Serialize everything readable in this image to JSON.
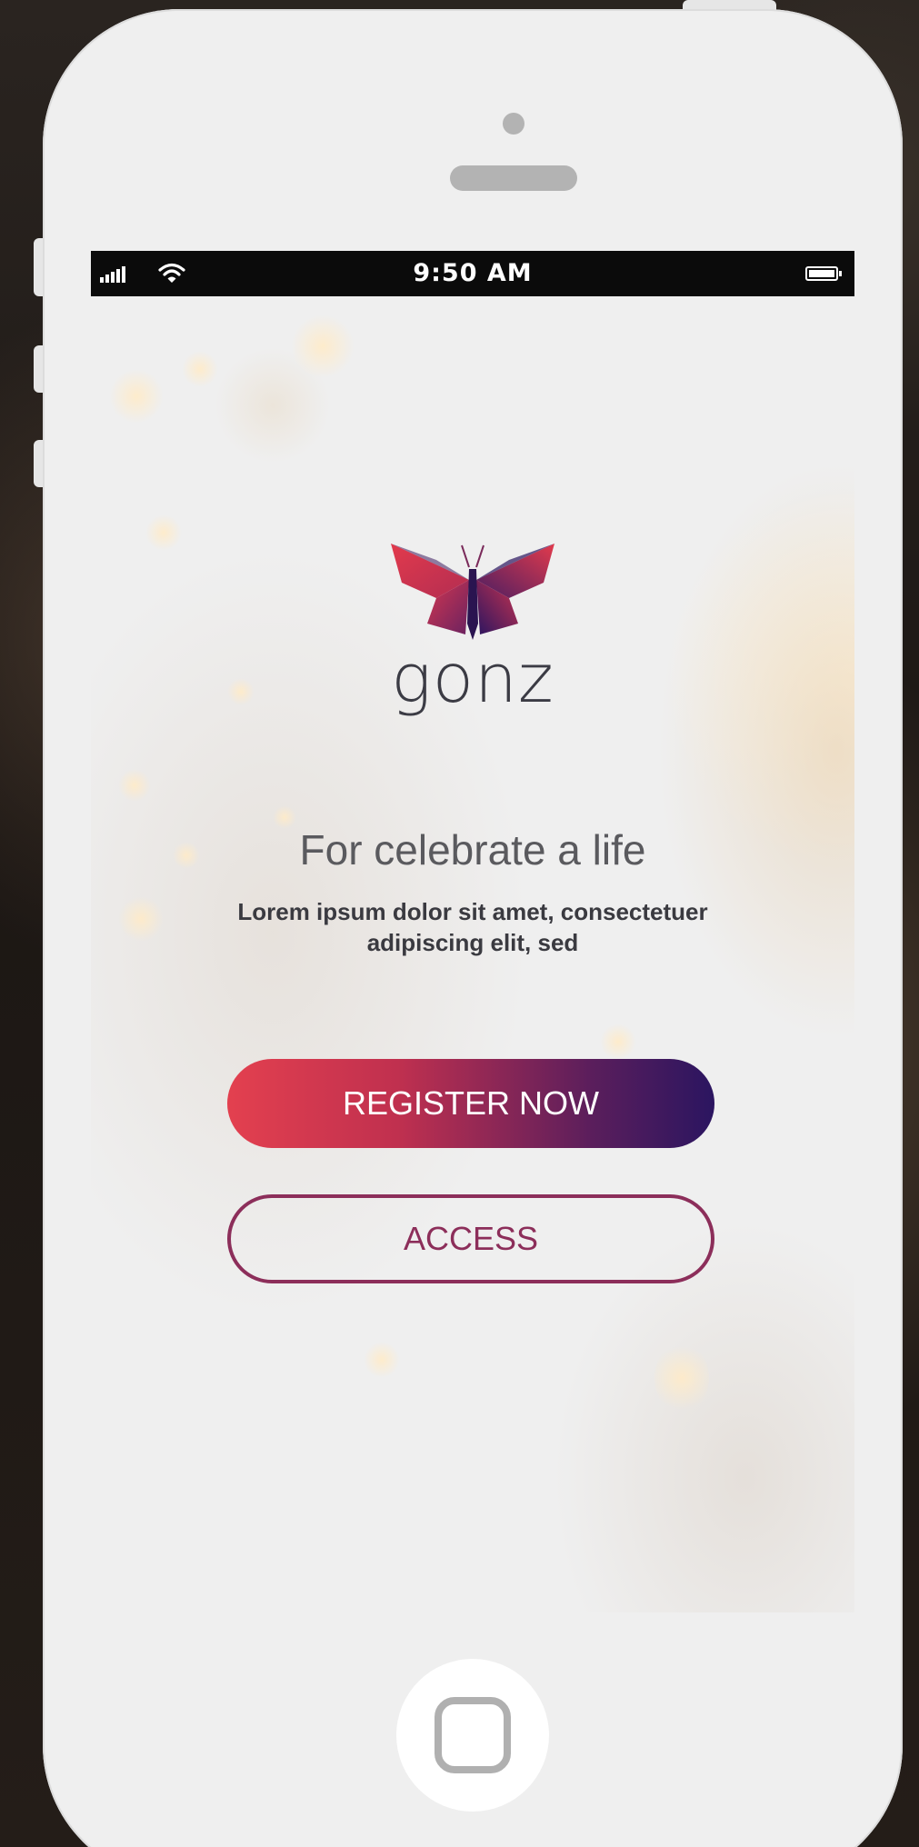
{
  "status_bar": {
    "time": "9:50 AM"
  },
  "app": {
    "brand_name": "gonz",
    "tagline": "For celebrate a life",
    "subtitle": "Lorem ipsum dolor sit amet, consectetuer adipiscing elit, sed"
  },
  "buttons": {
    "register_label": "REGISTER NOW",
    "access_label": "ACCESS"
  },
  "icons": {
    "signal": "signal-icon",
    "wifi": "wifi-icon",
    "battery": "battery-icon",
    "logo": "butterfly-logo-icon",
    "home": "home-button-icon"
  },
  "colors": {
    "brand_red": "#e3404f",
    "brand_purple": "#2b1560",
    "access_border": "#8c2e5a"
  }
}
